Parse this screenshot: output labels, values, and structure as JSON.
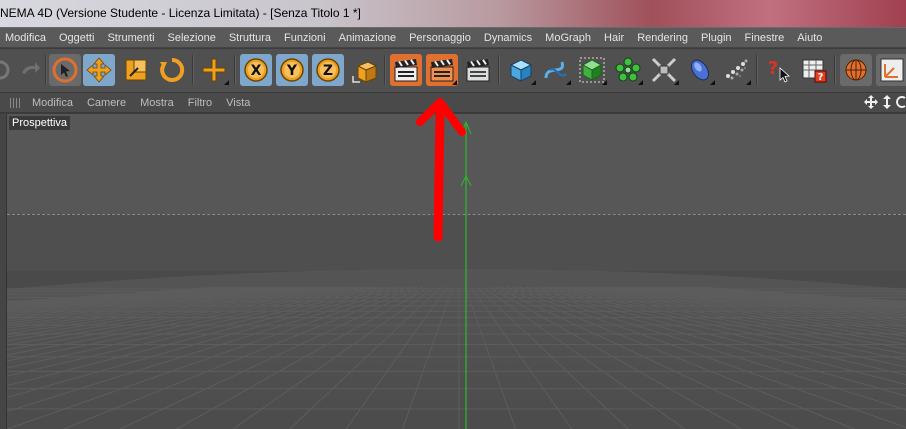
{
  "window": {
    "title": "NEMA 4D (Versione Studente - Licenza Limitata) - [Senza Titolo 1 *]"
  },
  "menu": {
    "items": [
      "Modifica",
      "Oggetti",
      "Strumenti",
      "Selezione",
      "Struttura",
      "Funzioni",
      "Animazione",
      "Personaggio",
      "Dynamics",
      "MoGraph",
      "Hair",
      "Rendering",
      "Plugin",
      "Finestre",
      "Aiuto"
    ]
  },
  "toolbar": {
    "axis_x": "X",
    "axis_y": "Y",
    "axis_z": "Z",
    "help_glyph": "?",
    "icons": [
      "undo-icon",
      "redo-icon",
      "live-selection-icon",
      "move-icon",
      "scale-icon",
      "rotate-icon",
      "move-tool-icon",
      "x-axis-icon",
      "y-axis-icon",
      "z-axis-icon",
      "coordinate-system-icon",
      "render-view-icon",
      "render-picture-viewer-icon",
      "render-settings-icon",
      "cube-icon",
      "spline-icon",
      "nurbs-icon",
      "array-icon",
      "deformer-icon",
      "environment-icon",
      "particles-icon",
      "help-icon",
      "render-tag-icon",
      "web-icon",
      "layout-icon"
    ]
  },
  "viewport_menu": {
    "items": [
      "Modifica",
      "Camere",
      "Mostra",
      "Filtro",
      "Vista"
    ]
  },
  "viewport": {
    "label": "Prospettiva"
  },
  "colors": {
    "active_blue": "#7fa7cc",
    "active_orange": "#e07030",
    "annotation_red": "#ff0000",
    "axis_green": "#2db82d"
  }
}
